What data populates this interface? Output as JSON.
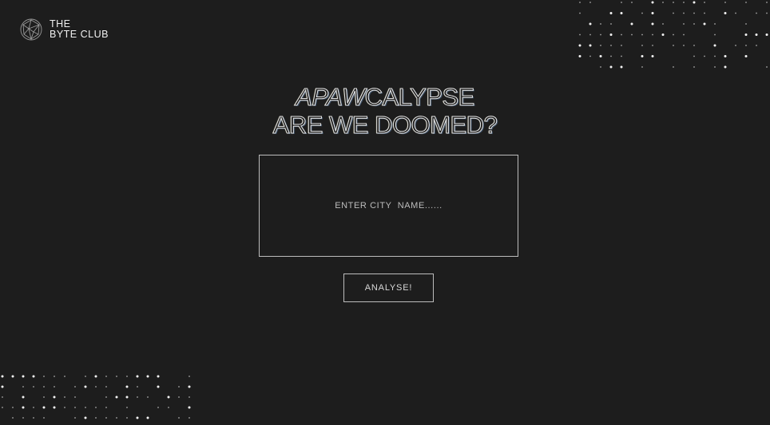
{
  "brand": {
    "line1": "THE",
    "line2": "BYTE CLUB"
  },
  "hero": {
    "title_part1": "APAW",
    "title_part2": "CALYPSE",
    "title_line2": "ARE WE DOOMED?"
  },
  "search": {
    "placeholder": "ENTER CITY  NAME......",
    "button_label": "ANALYSE!"
  },
  "colors": {
    "background": "#1d1d1d",
    "text": "#e8e8e8",
    "border": "#bdbdbd",
    "dot": "#ffffff"
  }
}
